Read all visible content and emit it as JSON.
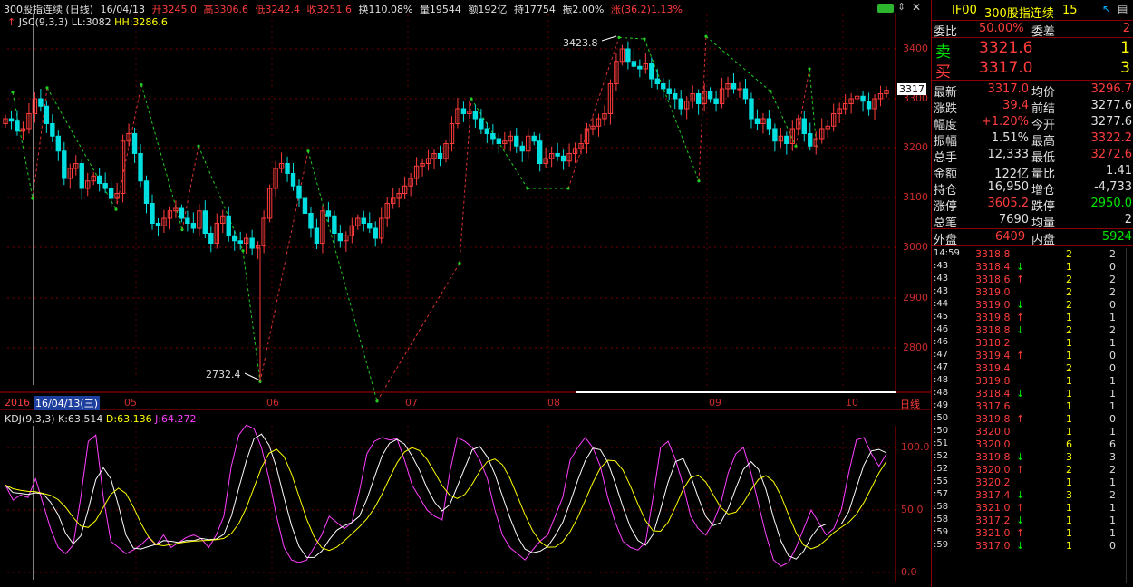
{
  "main_header": {
    "title": "300股指连续 (日线)",
    "date": "16/04/13",
    "open": "开3245.0",
    "high": "高3306.6",
    "low": "低3242.4",
    "close": "收3251.6",
    "turnover": "换110.08%",
    "volume": "量19544",
    "amount": "额192亿",
    "hold": "持17754",
    "amplitude": "振2.00%",
    "change": "涨(36.2)1.13%"
  },
  "jsc": {
    "label": "JSC(9,3,3)",
    "ll": "LL:3082",
    "hh": "HH:3286.6"
  },
  "price_axis": [
    "3400",
    "3300",
    "3200",
    "3100",
    "3000",
    "2900",
    "2800"
  ],
  "current_price_tag": "3317",
  "annotations": {
    "high": "3423.8",
    "low": "2732.4"
  },
  "date_axis": {
    "year": "2016",
    "selected_date": "16/04/13(三)",
    "months": [
      "05",
      "06",
      "07",
      "08",
      "09",
      "10"
    ],
    "period_label": "日线"
  },
  "kdj": {
    "label": "KDJ(9,3,3)",
    "k": "K:63.514",
    "d": "D:63.136",
    "j": "J:64.272",
    "axis": [
      "100.0",
      "50.0",
      "0.0"
    ]
  },
  "right_panel": {
    "code": "IF00",
    "name": "300股指连续",
    "num": "15",
    "weibi_label": "委比",
    "weibi": "50.00%",
    "weicha_label": "委差",
    "weicha": "2",
    "sell_label": "卖",
    "sell_price": "3321.6",
    "sell_vol": "1",
    "buy_label": "买",
    "buy_price": "3317.0",
    "buy_vol": "3",
    "stats": [
      {
        "l1": "最新",
        "v1": "3317.0",
        "c1": "red",
        "l2": "均价",
        "v2": "3296.7",
        "c2": "red"
      },
      {
        "l1": "涨跌",
        "v1": "39.4",
        "c1": "red",
        "l2": "前结",
        "v2": "3277.6",
        "c2": "white"
      },
      {
        "l1": "幅度",
        "v1": "+1.20%",
        "c1": "red",
        "l2": "今开",
        "v2": "3277.6",
        "c2": "white"
      },
      {
        "l1": "振幅",
        "v1": "1.51%",
        "c1": "white",
        "l2": "最高",
        "v2": "3322.2",
        "c2": "red"
      },
      {
        "l1": "总手",
        "v1": "12,333",
        "c1": "white",
        "l2": "最低",
        "v2": "3272.6",
        "c2": "red"
      },
      {
        "l1": "金额",
        "v1": "122亿",
        "c1": "white",
        "l2": "量比",
        "v2": "1.41",
        "c2": "white"
      },
      {
        "l1": "持仓",
        "v1": "16,950",
        "c1": "white",
        "l2": "增仓",
        "v2": "-4,733",
        "c2": "white"
      },
      {
        "l1": "涨停",
        "v1": "3605.2",
        "c1": "red",
        "l2": "跌停",
        "v2": "2950.0",
        "c2": "green"
      },
      {
        "l1": "总笔",
        "v1": "7690",
        "c1": "white",
        "l2": "均量",
        "v2": "2",
        "c2": "white"
      }
    ],
    "waipan_label": "外盘",
    "waipan": "6409",
    "neipan_label": "内盘",
    "neipan": "5924",
    "ticks": [
      {
        "t": "14:59",
        "p": "3318.8",
        "a": "",
        "v": "2",
        "c": "2"
      },
      {
        "t": ":43",
        "p": "3318.4",
        "a": "↓",
        "v": "1",
        "c": "0"
      },
      {
        "t": ":43",
        "p": "3318.6",
        "a": "↑",
        "v": "2",
        "c": "2"
      },
      {
        "t": ":43",
        "p": "3319.0",
        "a": "",
        "v": "2",
        "c": "2"
      },
      {
        "t": ":44",
        "p": "3319.0",
        "a": "↓",
        "v": "2",
        "c": "0"
      },
      {
        "t": ":45",
        "p": "3319.8",
        "a": "↑",
        "v": "1",
        "c": "1"
      },
      {
        "t": ":46",
        "p": "3318.8",
        "a": "↓",
        "v": "2",
        "c": "2"
      },
      {
        "t": ":46",
        "p": "3318.2",
        "a": "",
        "v": "1",
        "c": "1"
      },
      {
        "t": ":47",
        "p": "3319.4",
        "a": "↑",
        "v": "1",
        "c": "0"
      },
      {
        "t": ":47",
        "p": "3319.4",
        "a": "",
        "v": "2",
        "c": "0"
      },
      {
        "t": ":48",
        "p": "3319.8",
        "a": "",
        "v": "1",
        "c": "1"
      },
      {
        "t": ":48",
        "p": "3318.4",
        "a": "↓",
        "v": "1",
        "c": "1"
      },
      {
        "t": ":49",
        "p": "3317.6",
        "a": "",
        "v": "1",
        "c": "1"
      },
      {
        "t": ":50",
        "p": "3319.8",
        "a": "↑",
        "v": "1",
        "c": "0"
      },
      {
        "t": ":50",
        "p": "3320.0",
        "a": "",
        "v": "1",
        "c": "1"
      },
      {
        "t": ":51",
        "p": "3320.0",
        "a": "",
        "v": "6",
        "c": "6"
      },
      {
        "t": ":52",
        "p": "3319.8",
        "a": "↓",
        "v": "3",
        "c": "3"
      },
      {
        "t": ":52",
        "p": "3320.0",
        "a": "↑",
        "v": "2",
        "c": "2"
      },
      {
        "t": ":55",
        "p": "3320.2",
        "a": "",
        "v": "1",
        "c": "1"
      },
      {
        "t": ":57",
        "p": "3317.4",
        "a": "↓",
        "v": "3",
        "c": "2"
      },
      {
        "t": ":58",
        "p": "3321.0",
        "a": "↑",
        "v": "1",
        "c": "1"
      },
      {
        "t": ":58",
        "p": "3317.2",
        "a": "↓",
        "v": "1",
        "c": "1"
      },
      {
        "t": ":59",
        "p": "3321.0",
        "a": "↑",
        "v": "1",
        "c": "1"
      },
      {
        "t": ":59",
        "p": "3317.0",
        "a": "↓",
        "v": "1",
        "c": "0"
      }
    ]
  },
  "colors": {
    "up": "#ff3c3c",
    "down": "#00e0e0",
    "grid": "#8b0000",
    "k": "#ffffff",
    "d": "#ffff00",
    "j": "#ff40ff"
  }
}
